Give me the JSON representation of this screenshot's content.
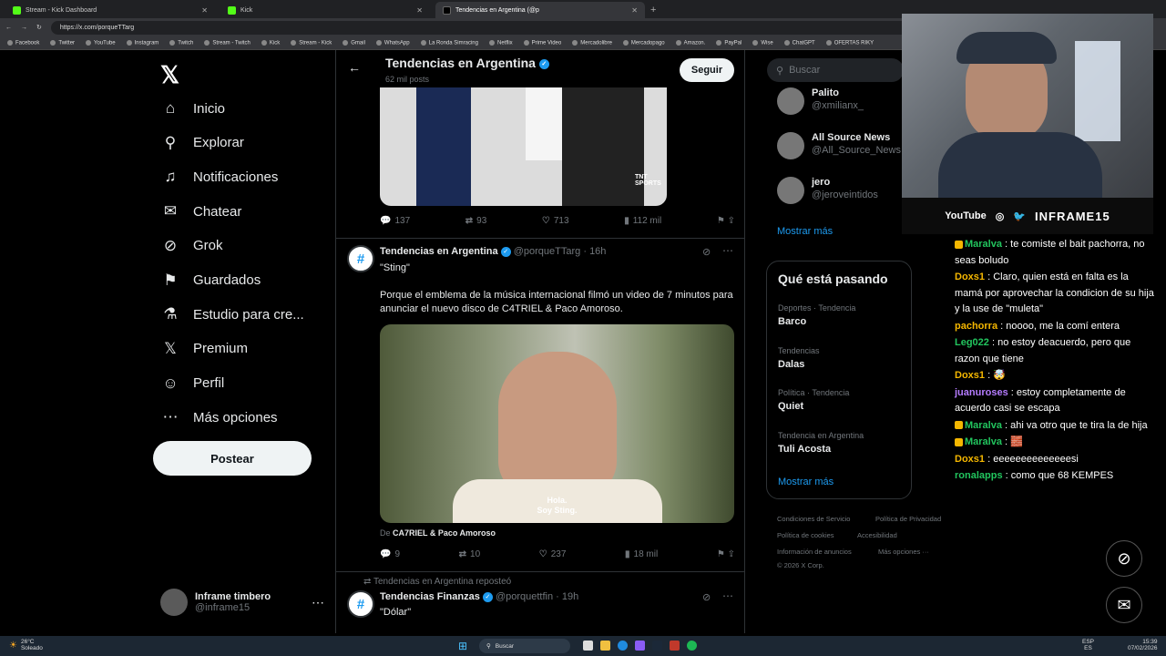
{
  "browser": {
    "tabs": [
      {
        "label": "Stream - Kick Dashboard",
        "active": false
      },
      {
        "label": "Kick",
        "active": false
      },
      {
        "label": "Tendencias en Argentina (@p",
        "active": true
      }
    ],
    "url": "https://x.com/porqueTTarg",
    "bookmarks": [
      "Facebook",
      "Twitter",
      "YouTube",
      "Instagram",
      "Twitch",
      "Stream - Twitch",
      "Kick",
      "Stream - Kick",
      "Gmail",
      "WhatsApp",
      "La Ronda Simracing",
      "Netflix",
      "Prime Video",
      "Mercadolibre",
      "Mercadopago",
      "Amazon.",
      "PayPal",
      "Wise",
      "ChatGPT",
      "OFERTAS RIKY"
    ]
  },
  "sidebar": {
    "nav": [
      {
        "label": "Inicio",
        "icon": "home-icon",
        "glyph": "⌂"
      },
      {
        "label": "Explorar",
        "icon": "search-icon",
        "glyph": "⚲"
      },
      {
        "label": "Notificaciones",
        "icon": "bell-icon",
        "glyph": "♫"
      },
      {
        "label": "Chatear",
        "icon": "mail-icon",
        "glyph": "✉"
      },
      {
        "label": "Grok",
        "icon": "grok-icon",
        "glyph": "⊘"
      },
      {
        "label": "Guardados",
        "icon": "bookmark-icon",
        "glyph": "⚑"
      },
      {
        "label": "Estudio para cre...",
        "icon": "flask-icon",
        "glyph": "⚗"
      },
      {
        "label": "Premium",
        "icon": "x-icon",
        "glyph": "𝕏"
      },
      {
        "label": "Perfil",
        "icon": "person-icon",
        "glyph": "☺"
      },
      {
        "label": "Más opciones",
        "icon": "more-icon",
        "glyph": "⋯"
      }
    ],
    "post_label": "Postear",
    "profile": {
      "name": "Inframe timbero",
      "handle": "@inframe15"
    }
  },
  "header": {
    "title": "Tendencias en Argentina",
    "subtitle": "62 mil posts",
    "follow_label": "Seguir"
  },
  "post1_stats": {
    "replies": "137",
    "reposts": "93",
    "likes": "713",
    "views": "112 mil",
    "image_badge": "TNT SPORTS"
  },
  "post2": {
    "name": "Tendencias en Argentina",
    "handle": "@porqueTTarg",
    "time": "16h",
    "title": "\"Sting\"",
    "body": "Porque el emblema de la música internacional filmó un video de 7 minutos para anunciar el nuevo disco de C4TRIEL & Paco Amoroso.",
    "caption": "Hola.\nSoy Sting.",
    "source_prefix": "De ",
    "source": "CA7RIEL & Paco Amoroso",
    "stats": {
      "replies": "9",
      "reposts": "10",
      "likes": "237",
      "views": "18 mil"
    }
  },
  "post3": {
    "repost_label": "Tendencias en Argentina reposteó",
    "name": "Tendencias Finanzas",
    "handle": "@porquettfin",
    "time": "19h",
    "title": "\"Dólar\""
  },
  "right": {
    "search_placeholder": "Buscar",
    "who_to_follow": [
      {
        "name": "Palito",
        "handle": "@xmilianx_"
      },
      {
        "name": "All Source News",
        "handle": "@All_Source_News"
      },
      {
        "name": "jero",
        "handle": "@jeroveintidos"
      }
    ],
    "show_more": "Mostrar más",
    "trends_title": "Qué está pasando",
    "trends": [
      {
        "category": "Deportes · Tendencia",
        "name": "Barco"
      },
      {
        "category": "Tendencias",
        "name": "Dalas"
      },
      {
        "category": "Política · Tendencia",
        "name": "Quiet"
      },
      {
        "category": "Tendencia en Argentina",
        "name": "Tuli Acosta"
      }
    ],
    "trends_more": "Mostrar más",
    "footer": [
      "Condiciones de Servicio",
      "Política de Privacidad",
      "Política de cookies",
      "Accesibilidad",
      "Información de anuncios",
      "Más opciones ···",
      "© 2026 X Corp."
    ]
  },
  "stream": {
    "socials": [
      "YouTube",
      "◎",
      "🐦"
    ],
    "channel": "INFRAME15",
    "chat": [
      {
        "user": "Maralva",
        "color": "#22c55e",
        "text": "te comiste el bait pachorra, no seas boludo",
        "badge": true
      },
      {
        "user": "Doxs1",
        "color": "#f5b700",
        "text": "Claro, quien está en falta es la mamá por aprovechar la condicion de su hija y la use de \"muleta\"",
        "badge": false
      },
      {
        "user": "pachorra",
        "color": "#f5b700",
        "text": "noooo, me la comí entera",
        "badge": false
      },
      {
        "user": "Leg022",
        "color": "#22c55e",
        "text": "no estoy deacuerdo, pero que razon que tiene",
        "badge": false
      },
      {
        "user": "Doxs1",
        "color": "#f5b700",
        "text": "🤯",
        "badge": false
      },
      {
        "user": "juanuroses",
        "color": "#b57cff",
        "text": "estoy completamente de acuerdo casi se escapa",
        "badge": false
      },
      {
        "user": "Maralva",
        "color": "#22c55e",
        "text": "ahi va otro que te tira la de hija",
        "badge": true
      },
      {
        "user": "Maralva",
        "color": "#22c55e",
        "text": "🧱",
        "badge": true
      },
      {
        "user": "Doxs1",
        "color": "#f5b700",
        "text": "eeeeeeeeeeeeeesi",
        "badge": false
      },
      {
        "user": "ronalapps",
        "color": "#22c55e",
        "text": "como que 68 KEMPES",
        "badge": false
      }
    ]
  },
  "taskbar": {
    "weather_temp": "26°C",
    "weather_desc": "Soleado",
    "search": "Buscar",
    "lang1": "ESP",
    "lang2": "ES",
    "time": "15:39",
    "date": "07/02/2026"
  }
}
